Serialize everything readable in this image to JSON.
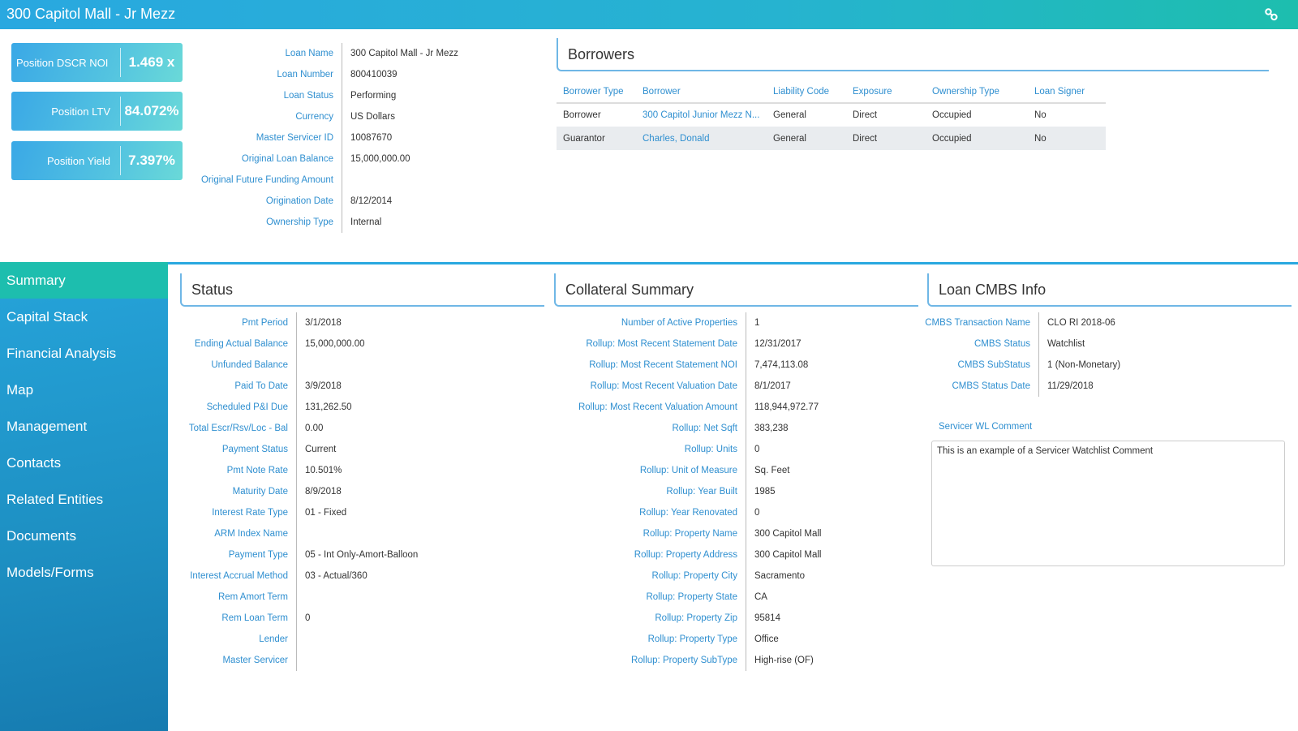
{
  "header": {
    "title": "300 Capitol Mall - Jr Mezz",
    "link_icon": "link-icon"
  },
  "kpis": [
    {
      "label": "Position DSCR NOI",
      "value": "1.469 x"
    },
    {
      "label": "Position LTV",
      "value": "84.072%"
    },
    {
      "label": "Position Yield",
      "value": "7.397%"
    }
  ],
  "loan_fields": [
    {
      "label": "Loan Name",
      "value": "300 Capitol Mall - Jr Mezz"
    },
    {
      "label": "Loan Number",
      "value": "800410039"
    },
    {
      "label": "Loan Status",
      "value": "Performing"
    },
    {
      "label": "Currency",
      "value": "US Dollars"
    },
    {
      "label": "Master Servicer ID",
      "value": "10087670"
    },
    {
      "label": "Original Loan Balance",
      "value": "15,000,000.00"
    },
    {
      "label": "Original Future Funding Amount",
      "value": ""
    },
    {
      "label": "Origination Date",
      "value": "8/12/2014"
    },
    {
      "label": "Ownership Type",
      "value": "Internal"
    }
  ],
  "borrowers": {
    "title": "Borrowers",
    "columns": [
      "Borrower Type",
      "Borrower",
      "Liability Code",
      "Exposure",
      "Ownership Type",
      "Loan Signer"
    ],
    "rows": [
      [
        "Borrower",
        "300 Capitol Junior Mezz N...",
        "General",
        "Direct",
        "Occupied",
        "No"
      ],
      [
        "Guarantor",
        "Charles, Donald",
        "General",
        "Direct",
        "Occupied",
        "No"
      ]
    ]
  },
  "sidebar": {
    "active": "Summary",
    "items": [
      {
        "label": "Summary"
      },
      {
        "label": "Capital Stack"
      },
      {
        "label": "Financial Analysis"
      },
      {
        "label": "Map"
      },
      {
        "label": "Management"
      },
      {
        "label": "Contacts"
      },
      {
        "label": "Related Entities"
      },
      {
        "label": "Documents"
      },
      {
        "label": "Models/Forms"
      }
    ]
  },
  "status": {
    "title": "Status",
    "fields": [
      {
        "label": "Pmt Period",
        "value": "3/1/2018"
      },
      {
        "label": "Ending Actual Balance",
        "value": "15,000,000.00"
      },
      {
        "label": "Unfunded Balance",
        "value": ""
      },
      {
        "label": "Paid To Date",
        "value": "3/9/2018"
      },
      {
        "label": "Scheduled P&I Due",
        "value": "131,262.50"
      },
      {
        "label": "Total Escr/Rsv/Loc - Bal",
        "value": "0.00"
      },
      {
        "label": "Payment Status",
        "value": "Current"
      },
      {
        "label": "Pmt Note Rate",
        "value": "10.501%"
      },
      {
        "label": "Maturity Date",
        "value": "8/9/2018"
      },
      {
        "label": "Interest Rate Type",
        "value": "01 - Fixed"
      },
      {
        "label": "ARM Index Name",
        "value": ""
      },
      {
        "label": "Payment Type",
        "value": "05 - Int Only-Amort-Balloon"
      },
      {
        "label": "Interest Accrual Method",
        "value": "03 - Actual/360"
      },
      {
        "label": "Rem Amort Term",
        "value": ""
      },
      {
        "label": "Rem Loan Term",
        "value": "0"
      },
      {
        "label": "Lender",
        "value": ""
      },
      {
        "label": "Master Servicer",
        "value": ""
      }
    ]
  },
  "collateral": {
    "title": "Collateral Summary",
    "fields": [
      {
        "label": "Number of Active Properties",
        "value": "1"
      },
      {
        "label": "Rollup: Most Recent Statement Date",
        "value": "12/31/2017"
      },
      {
        "label": "Rollup: Most Recent Statement NOI",
        "value": "7,474,113.08"
      },
      {
        "label": "Rollup: Most Recent Valuation Date",
        "value": "8/1/2017"
      },
      {
        "label": "Rollup: Most Recent Valuation Amount",
        "value": "118,944,972.77"
      },
      {
        "label": "Rollup: Net Sqft",
        "value": "383,238"
      },
      {
        "label": "Rollup: Units",
        "value": "0"
      },
      {
        "label": "Rollup: Unit of Measure",
        "value": "Sq. Feet"
      },
      {
        "label": "Rollup: Year Built",
        "value": "1985"
      },
      {
        "label": "Rollup: Year Renovated",
        "value": "0"
      },
      {
        "label": "Rollup: Property Name",
        "value": "300 Capitol Mall"
      },
      {
        "label": "Rollup: Property Address",
        "value": "300 Capitol Mall"
      },
      {
        "label": "Rollup: Property City",
        "value": "Sacramento"
      },
      {
        "label": "Rollup: Property State",
        "value": "CA"
      },
      {
        "label": "Rollup: Property Zip",
        "value": "95814"
      },
      {
        "label": "Rollup: Property Type",
        "value": "Office"
      },
      {
        "label": "Rollup: Property SubType",
        "value": "High-rise (OF)"
      }
    ]
  },
  "cmbs": {
    "title": "Loan CMBS Info",
    "fields": [
      {
        "label": "CMBS Transaction Name",
        "value": "CLO RI 2018-06"
      },
      {
        "label": "CMBS Status",
        "value": "Watchlist"
      },
      {
        "label": "CMBS SubStatus",
        "value": "1 (Non-Monetary)"
      },
      {
        "label": "CMBS Status Date",
        "value": "11/29/2018"
      }
    ],
    "wl_comment_label": "Servicer WL Comment",
    "wl_comment_value": "This is an example of a Servicer Watchlist Comment"
  },
  "colors": {
    "accent_blue": "#29a8e0",
    "accent_teal": "#1dbeae",
    "label_blue": "#2f8fd0"
  }
}
